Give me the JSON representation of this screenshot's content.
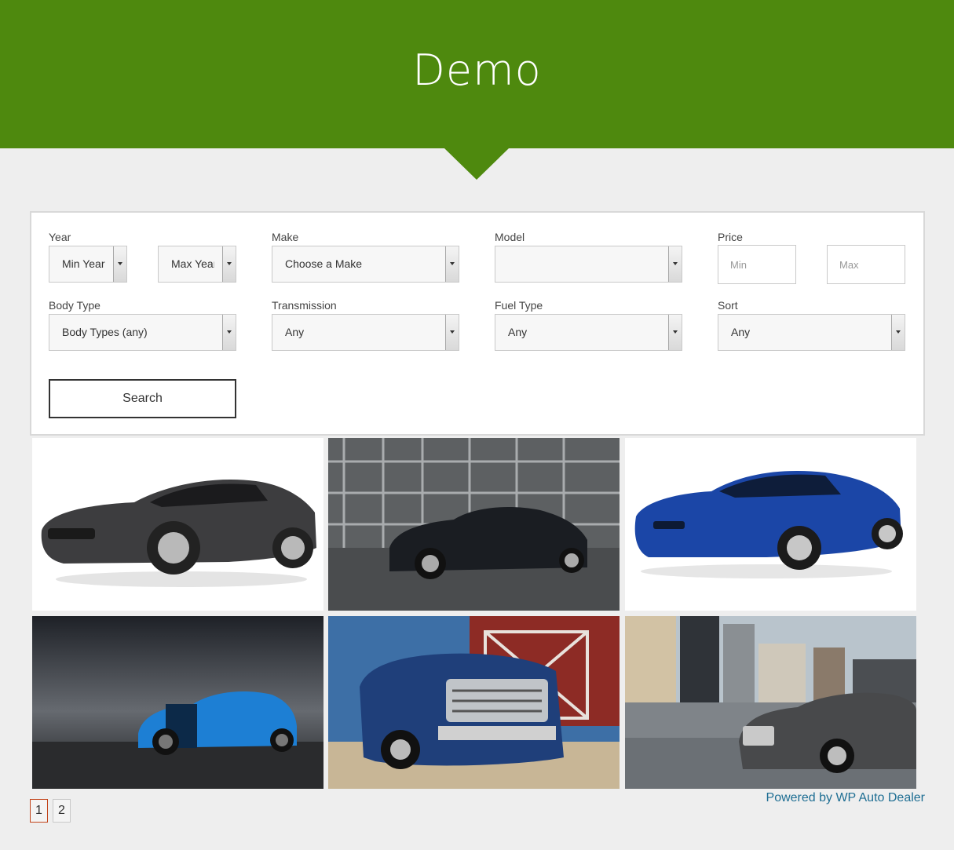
{
  "banner": {
    "title": "Demo"
  },
  "search": {
    "year_label": "Year",
    "min_year": "Min Year",
    "max_year": "Max Year",
    "make_label": "Make",
    "make_value": "Choose a Make",
    "model_label": "Model",
    "model_value": "",
    "price_label": "Price",
    "price_min_placeholder": "Min",
    "price_max_placeholder": "Max",
    "body_label": "Body Type",
    "body_value": "Body Types (any)",
    "transmission_label": "Transmission",
    "transmission_value": "Any",
    "fuel_label": "Fuel Type",
    "fuel_value": "Any",
    "sort_label": "Sort",
    "sort_value": "Any",
    "button_label": "Search"
  },
  "listings": [
    {
      "color": "#3d3d3f",
      "bg": "#ffffff",
      "icon": "car-photo"
    },
    {
      "color": "#1a1d22",
      "bg": "#6d6f70",
      "icon": "car-photo"
    },
    {
      "color": "#1b46a7",
      "bg": "#ffffff",
      "icon": "car-photo"
    },
    {
      "color": "#1d7fd4",
      "bg": "#2d3035",
      "icon": "car-photo"
    },
    {
      "color": "#1f3f7a",
      "bg": "#3d6fa6",
      "icon": "truck-photo"
    },
    {
      "color": "#48494b",
      "bg": "#a9b2b9",
      "icon": "car-photo"
    }
  ],
  "pagination": {
    "pages": [
      "1",
      "2"
    ],
    "current": "1"
  },
  "footer": {
    "powered_by": "Powered by WP Auto Dealer"
  },
  "colors": {
    "banner": "#4e890e",
    "link": "#1e6e93",
    "pager_active": "#c2431a"
  }
}
